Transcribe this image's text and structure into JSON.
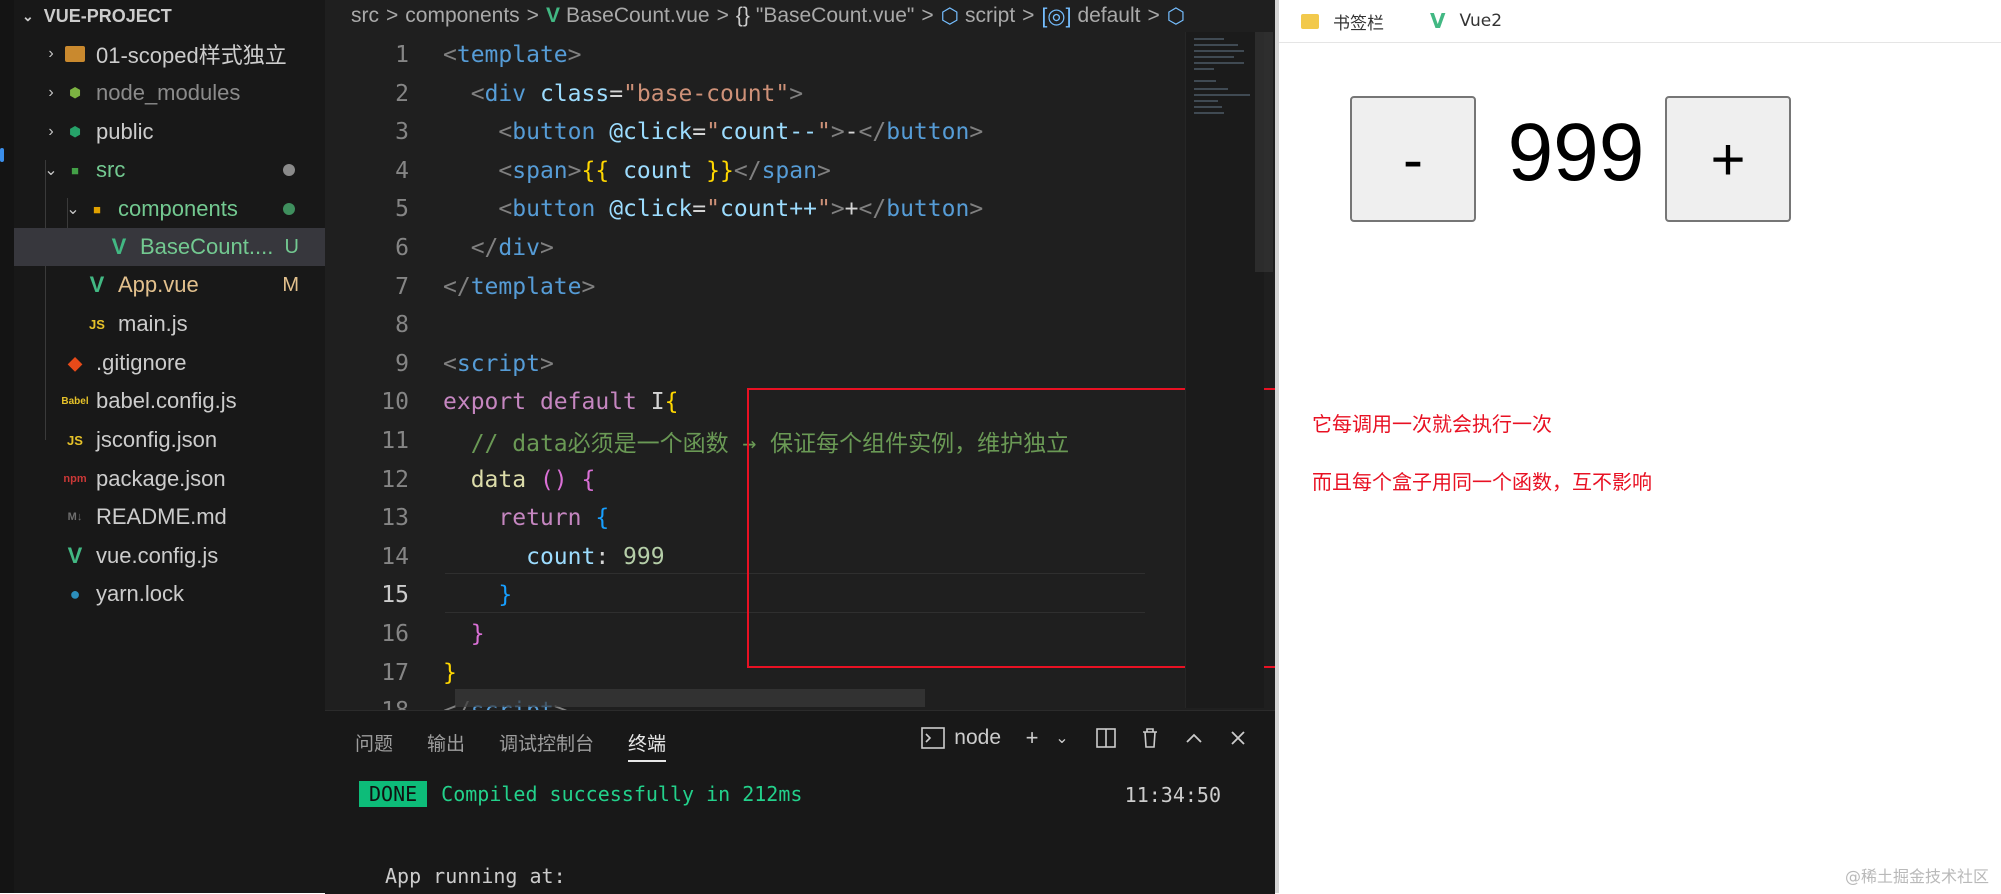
{
  "explorer": {
    "title": "VUE-PROJECT",
    "items": [
      {
        "label": "01-scoped样式独立",
        "chevron": "›",
        "icon": "folder-icon"
      },
      {
        "label": "node_modules",
        "chevron": "›",
        "icon": "node-modules-folder-icon"
      },
      {
        "label": "public",
        "chevron": "›",
        "icon": "public-folder-icon"
      },
      {
        "label": "src",
        "chevron": "⌄",
        "icon": "src-folder-icon"
      },
      {
        "label": "components",
        "chevron": "⌄",
        "icon": "components-folder-icon"
      },
      {
        "label": "BaseCount....",
        "badge": "U",
        "icon": "vue-file-icon"
      },
      {
        "label": "App.vue",
        "badge": "M",
        "icon": "vue-file-icon"
      },
      {
        "label": "main.js",
        "icon": "js-file-icon"
      },
      {
        "label": ".gitignore",
        "icon": "git-icon"
      },
      {
        "label": "babel.config.js",
        "icon": "babel-icon"
      },
      {
        "label": "jsconfig.json",
        "icon": "js-file-icon"
      },
      {
        "label": "package.json",
        "icon": "npm-icon"
      },
      {
        "label": "README.md",
        "icon": "markdown-icon"
      },
      {
        "label": "vue.config.js",
        "icon": "vue-config-icon"
      },
      {
        "label": "yarn.lock",
        "icon": "yarn-icon"
      }
    ]
  },
  "breadcrumb": {
    "parts": [
      "src",
      "components",
      "BaseCount.vue",
      "\"BaseCount.vue\"",
      "script",
      "default"
    ],
    "sep": ">",
    "braces": "{}"
  },
  "editor": {
    "active_line": 15,
    "lines": [
      {
        "n": "1",
        "tokens": [
          [
            "punc",
            "<"
          ],
          [
            "tag",
            "template"
          ],
          [
            "punc",
            ">"
          ]
        ]
      },
      {
        "n": "2",
        "tokens": [
          [
            "txt",
            "  "
          ],
          [
            "punc",
            "<"
          ],
          [
            "tag",
            "div"
          ],
          [
            "txt",
            " "
          ],
          [
            "attr",
            "class"
          ],
          [
            "txt",
            "="
          ],
          [
            "str",
            "\"base-count\""
          ],
          [
            "punc",
            ">"
          ]
        ]
      },
      {
        "n": "3",
        "tokens": [
          [
            "txt",
            "    "
          ],
          [
            "punc",
            "<"
          ],
          [
            "tag",
            "button"
          ],
          [
            "txt",
            " "
          ],
          [
            "attr",
            "@click"
          ],
          [
            "txt",
            "="
          ],
          [
            "str",
            "\""
          ],
          [
            "var",
            "count--"
          ],
          [
            "str",
            "\""
          ],
          [
            "punc",
            ">"
          ],
          [
            "txt",
            "-"
          ],
          [
            "punc",
            "</"
          ],
          [
            "tag",
            "button"
          ],
          [
            "punc",
            ">"
          ]
        ]
      },
      {
        "n": "4",
        "tokens": [
          [
            "txt",
            "    "
          ],
          [
            "punc",
            "<"
          ],
          [
            "tag",
            "span"
          ],
          [
            "punc",
            ">"
          ],
          [
            "brk1",
            "{{"
          ],
          [
            "txt",
            " "
          ],
          [
            "var",
            "count"
          ],
          [
            "txt",
            " "
          ],
          [
            "brk1",
            "}}"
          ],
          [
            "punc",
            "</"
          ],
          [
            "tag",
            "span"
          ],
          [
            "punc",
            ">"
          ]
        ]
      },
      {
        "n": "5",
        "tokens": [
          [
            "txt",
            "    "
          ],
          [
            "punc",
            "<"
          ],
          [
            "tag",
            "button"
          ],
          [
            "txt",
            " "
          ],
          [
            "attr",
            "@click"
          ],
          [
            "txt",
            "="
          ],
          [
            "str",
            "\""
          ],
          [
            "var",
            "count++"
          ],
          [
            "str",
            "\""
          ],
          [
            "punc",
            ">"
          ],
          [
            "txt",
            "+"
          ],
          [
            "punc",
            "</"
          ],
          [
            "tag",
            "button"
          ],
          [
            "punc",
            ">"
          ]
        ]
      },
      {
        "n": "6",
        "tokens": [
          [
            "txt",
            "  "
          ],
          [
            "punc",
            "</"
          ],
          [
            "tag",
            "div"
          ],
          [
            "punc",
            ">"
          ]
        ]
      },
      {
        "n": "7",
        "tokens": [
          [
            "punc",
            "</"
          ],
          [
            "tag",
            "template"
          ],
          [
            "punc",
            ">"
          ]
        ]
      },
      {
        "n": "8",
        "tokens": []
      },
      {
        "n": "9",
        "tokens": [
          [
            "punc",
            "<"
          ],
          [
            "tag",
            "script"
          ],
          [
            "punc",
            ">"
          ]
        ]
      },
      {
        "n": "10",
        "tokens": [
          [
            "kw",
            "export"
          ],
          [
            "txt",
            " "
          ],
          [
            "kw",
            "default"
          ],
          [
            "txt",
            " "
          ],
          [
            "txt",
            "I"
          ],
          [
            "brk1",
            "{"
          ]
        ]
      },
      {
        "n": "11",
        "tokens": [
          [
            "txt",
            "  "
          ],
          [
            "cmt",
            "// data必须是一个函数 → 保证每个组件实例，维护独立"
          ]
        ]
      },
      {
        "n": "12",
        "tokens": [
          [
            "txt",
            "  "
          ],
          [
            "fn",
            "data"
          ],
          [
            "txt",
            " "
          ],
          [
            "brk2",
            "()"
          ],
          [
            "txt",
            " "
          ],
          [
            "brk2",
            "{"
          ]
        ]
      },
      {
        "n": "13",
        "tokens": [
          [
            "txt",
            "    "
          ],
          [
            "kw",
            "return"
          ],
          [
            "txt",
            " "
          ],
          [
            "brk3",
            "{"
          ]
        ]
      },
      {
        "n": "14",
        "tokens": [
          [
            "txt",
            "      "
          ],
          [
            "var",
            "count"
          ],
          [
            "txt",
            ": "
          ],
          [
            "num",
            "999"
          ]
        ]
      },
      {
        "n": "15",
        "tokens": [
          [
            "txt",
            "    "
          ],
          [
            "brk3",
            "}"
          ]
        ]
      },
      {
        "n": "16",
        "tokens": [
          [
            "txt",
            "  "
          ],
          [
            "brk2",
            "}"
          ]
        ]
      },
      {
        "n": "17",
        "tokens": [
          [
            "brk1",
            "}"
          ]
        ]
      },
      {
        "n": "18",
        "tokens": [
          [
            "punc",
            "</"
          ],
          [
            "tag",
            "script"
          ],
          [
            "punc",
            ">"
          ]
        ]
      }
    ]
  },
  "panel": {
    "tabs": [
      "问题",
      "输出",
      "调试控制台",
      "终端"
    ],
    "active_tab": "终端",
    "terminal_name": "node",
    "done_badge": "DONE",
    "compiled_msg": "Compiled successfully in 212ms",
    "time": "11:34:50",
    "running_msg": "App running at:"
  },
  "browser": {
    "bookmarks": [
      {
        "label": "书签栏",
        "icon": "folder-icon"
      },
      {
        "label": "Vue2",
        "icon": "vue-icon"
      }
    ],
    "minus_label": "-",
    "count": "999",
    "plus_label": "+",
    "note1": "它每调用一次就会执行一次",
    "note2": "而且每个盒子用同一个函数，互不影响",
    "watermark": "@稀土掘金技术社区"
  },
  "colors": {
    "accent_red": "#e81123",
    "vue_green": "#42b883",
    "terminal_green": "#23d18b"
  }
}
